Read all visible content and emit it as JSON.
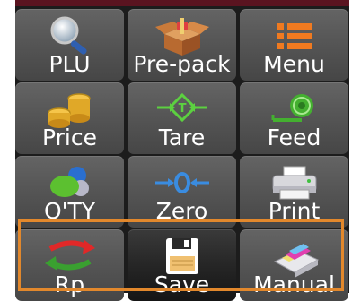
{
  "colors": {
    "key_face": "#565656",
    "save_key_face": "#262626",
    "label_text": "#ffffff",
    "selection_border": "#e2882c"
  },
  "keys": [
    {
      "label": "PLU",
      "icon": "magnifier-icon"
    },
    {
      "label": "Pre-pack",
      "icon": "open-box-icon"
    },
    {
      "label": "Menu",
      "icon": "list-icon"
    },
    {
      "label": "Price",
      "icon": "coins-icon"
    },
    {
      "label": "Tare",
      "icon": "tare-diamond-icon"
    },
    {
      "label": "Feed",
      "icon": "paper-roll-icon"
    },
    {
      "label": "Q'TY",
      "icon": "colored-circles-icon"
    },
    {
      "label": "Zero",
      "icon": "zero-arrows-icon"
    },
    {
      "label": "Print",
      "icon": "printer-icon"
    },
    {
      "label": "Rp",
      "icon": "swap-arrows-icon"
    },
    {
      "label": "Save",
      "icon": "floppy-disk-icon"
    },
    {
      "label": "Manual",
      "icon": "manual-printer-icon"
    }
  ]
}
